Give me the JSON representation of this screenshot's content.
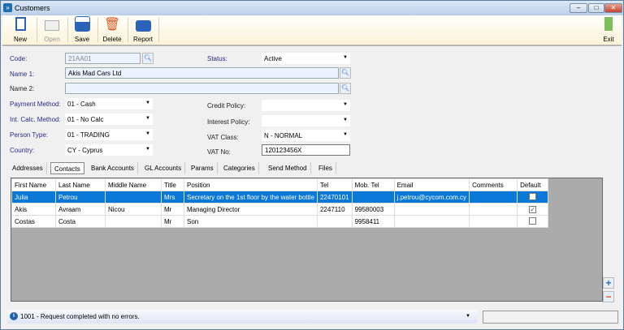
{
  "window": {
    "title": "Customers"
  },
  "toolbar": [
    {
      "label": "New",
      "icon": "new-document-icon"
    },
    {
      "label": "Open",
      "icon": "folder-icon",
      "disabled": true
    },
    {
      "label": "Save",
      "icon": "floppy-disk-icon"
    },
    {
      "label": "Delete",
      "icon": "trash-person-icon"
    },
    {
      "label": "Report",
      "icon": "printer-icon"
    }
  ],
  "exit_label": "Exit",
  "form": {
    "code": {
      "label": "Code:",
      "value": "21AA01"
    },
    "name1": {
      "label": "Name 1:",
      "value": "Akis Mad Cars Ltd"
    },
    "name2": {
      "label": "Name 2:",
      "value": ""
    },
    "payment": {
      "label": "Payment Method:",
      "value": "01 - Cash"
    },
    "intcalc": {
      "label": "Int. Calc. Method:",
      "value": "01 - No Calc"
    },
    "persontype": {
      "label": "Person Type:",
      "value": "01 - TRADING"
    },
    "country": {
      "label": "Country:",
      "value": "CY - Cyprus"
    },
    "status": {
      "label": "Status:",
      "value": "Active"
    },
    "credit": {
      "label": "Credit Policy:",
      "value": ""
    },
    "interest": {
      "label": "Interest Policy:",
      "value": ""
    },
    "vatclass": {
      "label": "VAT Class:",
      "value": "N - NORMAL"
    },
    "vatno": {
      "label": "VAT No:",
      "value": "120123456X"
    }
  },
  "tabs": [
    "Addresses",
    "Contacts",
    "Bank Accounts",
    "GL Accounts",
    "Params",
    "Categories",
    "Send Method",
    "Files"
  ],
  "active_tab": "Contacts",
  "grid": {
    "columns": [
      "First Name",
      "Last Name",
      "Middle Name",
      "Title",
      "Position",
      "Tel",
      "Mob. Tel",
      "Email",
      "Comments",
      "Default"
    ],
    "rows": [
      [
        "Julia",
        "Petrou",
        "",
        "Mrs",
        "Secretary on the 1st floor by the water bottle",
        "22470101",
        "",
        "j.petrou@cycom.com.cy",
        "",
        false
      ],
      [
        "Akis",
        "Avraam",
        "Nicou",
        "Mr",
        "Managing Director",
        "2247110",
        "99580003",
        "",
        "",
        true
      ],
      [
        "Costas",
        "Costa",
        "",
        "Mr",
        "Son",
        "",
        "9958411",
        "",
        "",
        false
      ]
    ]
  },
  "statusbar": {
    "message": "1001 -  Request completed with no errors."
  },
  "colors": {
    "selection": "#0a78d7",
    "grid_bg": "#ababab"
  }
}
